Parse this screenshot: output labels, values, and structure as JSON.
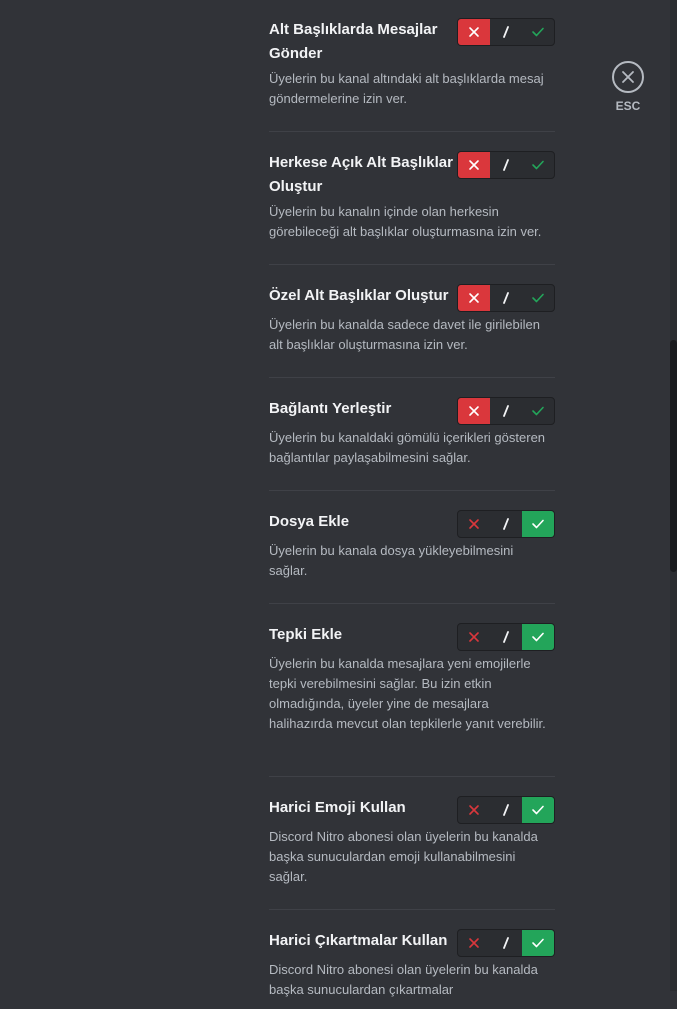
{
  "close": {
    "icon": "close-icon",
    "label": "ESC"
  },
  "toggle": {
    "deny_icon": "x-icon",
    "neutral_icon": "slash-icon",
    "allow_icon": "check-icon"
  },
  "colors": {
    "deny": "#da373c",
    "allow": "#23a55a",
    "background": "#313338"
  },
  "permissions": [
    {
      "title": "Alt Başlıklarda Mesajlar Gönder",
      "title_lines": [
        "Alt Başlıklarda Mesajlar",
        "Gönder"
      ],
      "desc": "Üyelerin bu kanal altındaki alt başlıklarda mesaj göndermelerine izin ver.",
      "state": "deny"
    },
    {
      "title": "Herkese Açık Alt Başlıklar Oluştur",
      "title_lines": [
        "Herkese Açık Alt Başlıklar",
        "Oluştur"
      ],
      "desc": "Üyelerin bu kanalın içinde olan herkesin görebileceği alt başlıklar oluşturmasına izin ver.",
      "state": "deny"
    },
    {
      "title": "Özel Alt Başlıklar Oluştur",
      "title_lines": [
        "Özel Alt Başlıklar Oluştur"
      ],
      "desc": "Üyelerin bu kanalda sadece davet ile girilebilen alt başlıklar oluşturmasına izin ver.",
      "state": "deny"
    },
    {
      "title": "Bağlantı Yerleştir",
      "title_lines": [
        "Bağlantı Yerleştir"
      ],
      "desc": "Üyelerin bu kanaldaki gömülü içerikleri gösteren bağlantılar paylaşabilmesini sağlar.",
      "state": "deny"
    },
    {
      "title": "Dosya Ekle",
      "title_lines": [
        "Dosya Ekle"
      ],
      "desc": "Üyelerin bu kanala dosya yükleyebilmesini sağlar.",
      "state": "allow"
    },
    {
      "title": "Tepki Ekle",
      "title_lines": [
        "Tepki Ekle"
      ],
      "desc": "Üyelerin bu kanalda mesajlara yeni emojilerle tepki verebilmesini sağlar. Bu izin etkin olmadığında, üyeler yine de mesajlara halihazırda mevcut olan tepkilerle yanıt verebilir.",
      "state": "allow"
    },
    {
      "title": "Harici Emoji Kullan",
      "title_lines": [
        "Harici Emoji Kullan"
      ],
      "desc": "Discord Nitro abonesi olan üyelerin bu kanalda başka sunuculardan emoji kullanabilmesini sağlar.",
      "state": "allow"
    },
    {
      "title": "Harici Çıkartmalar Kullan",
      "title_lines": [
        "Harici Çıkartmalar Kullan"
      ],
      "desc": "Discord Nitro abonesi olan üyelerin bu kanalda başka sunuculardan çıkartmalar",
      "state": "allow"
    }
  ]
}
